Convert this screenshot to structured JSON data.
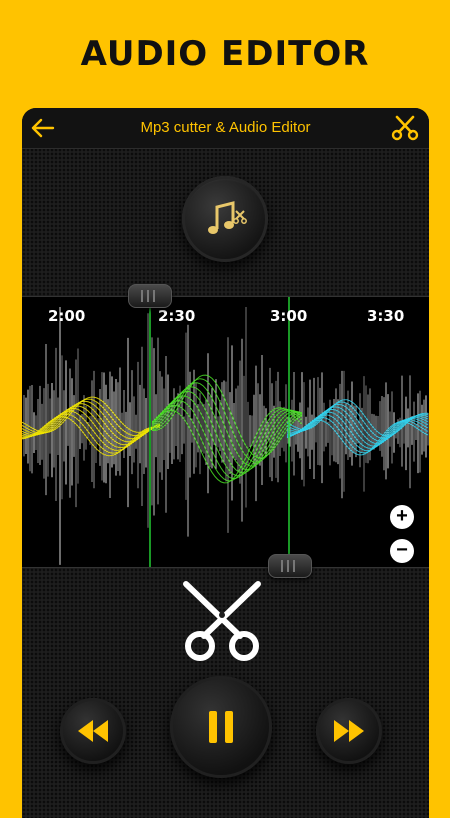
{
  "banner": {
    "title": "AUDIO EDITOR"
  },
  "app": {
    "title": "Mp3 cutter & Audio Editor"
  },
  "timeline": {
    "ticks": [
      "2:00",
      "2:30",
      "3:00",
      "3:30"
    ]
  },
  "zoom": {
    "in_label": "+",
    "out_label": "−"
  },
  "icons": {
    "back": "arrow-left-icon",
    "scissor": "scissors-icon",
    "music": "music-note-scissors-icon",
    "cut": "scissors-icon",
    "rewind": "rewind-icon",
    "pause": "pause-icon",
    "forward": "fast-forward-icon"
  },
  "colors": {
    "accent": "#FFC300",
    "background": "#1e1e1e",
    "wave_yellow": "#F2E600",
    "wave_green": "#49E024",
    "wave_cyan": "#2FD3F0",
    "marker_line": "#22CC33"
  }
}
